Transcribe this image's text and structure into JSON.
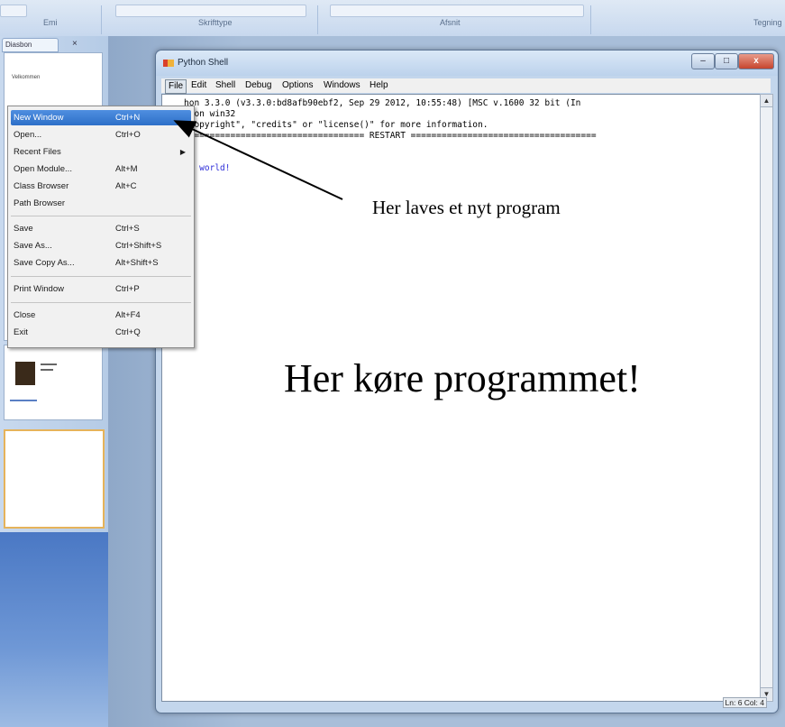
{
  "ribbon": {
    "labels": [
      "Emi",
      "Skrifttype",
      "Afsnit",
      "Tegning"
    ]
  },
  "left_pane": {
    "tab_label": "Diasbon",
    "close": "×",
    "thumb_text": "Velkommen"
  },
  "window": {
    "title": "Python Shell",
    "controls": {
      "minimize": "–",
      "maximize": "□",
      "close": "x"
    }
  },
  "menu": {
    "items": [
      "File",
      "Edit",
      "Shell",
      "Debug",
      "Options",
      "Windows",
      "Help"
    ],
    "active": "File"
  },
  "shell": {
    "lines": [
      "hon 3.3.0 (v3.3.0:bd8afb90ebf2, Sep 29 2012, 10:55:48) [MSC v.1600 32 bit (In",
      ") on win32",
      "\"copyright\", \"credits\" or \"license()\" for more information.",
      "=================================== RESTART ====================================",
      "lo world!"
    ]
  },
  "status": {
    "text": "Ln: 6 Col: 4"
  },
  "file_menu": {
    "items": [
      {
        "label": "New Window",
        "accel": "Ctrl+N"
      },
      {
        "label": "Open...",
        "accel": "Ctrl+O"
      },
      {
        "label": "Recent Files",
        "accel": ""
      },
      {
        "label": "Open Module...",
        "accel": "Alt+M"
      },
      {
        "label": "Class Browser",
        "accel": "Alt+C"
      },
      {
        "label": "Path Browser",
        "accel": ""
      },
      {
        "label": "Save",
        "accel": "Ctrl+S"
      },
      {
        "label": "Save As...",
        "accel": "Ctrl+Shift+S"
      },
      {
        "label": "Save Copy As...",
        "accel": "Alt+Shift+S"
      },
      {
        "label": "Print Window",
        "accel": "Ctrl+P"
      },
      {
        "label": "Close",
        "accel": "Alt+F4"
      },
      {
        "label": "Exit",
        "accel": "Ctrl+Q"
      }
    ],
    "submenu_arrow": "▶"
  },
  "annotations": {
    "arrow_label": "Her laves et nyt program",
    "big_label": "Her køre programmet!"
  },
  "colors": {
    "highlight": "#2d6fc8",
    "output_text": "#2e2ed8"
  }
}
